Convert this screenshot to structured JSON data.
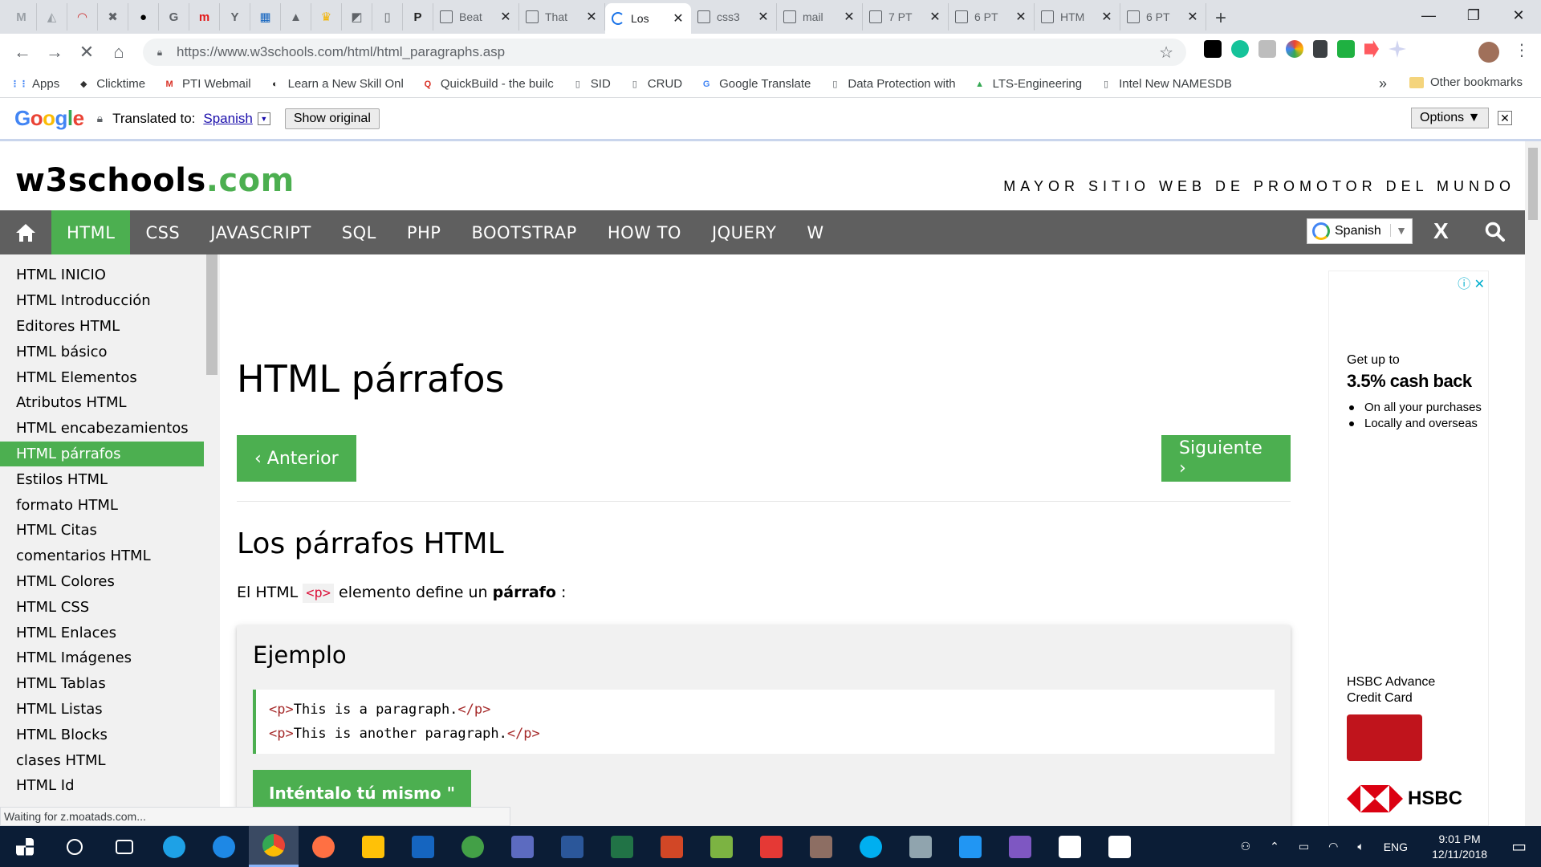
{
  "browser": {
    "pinned": [
      {
        "name": "gmail-icon",
        "color": "#9aa0a6",
        "glyph": "M"
      },
      {
        "name": "drive-icon",
        "color": "#9aa0a6",
        "glyph": "◭"
      },
      {
        "name": "app-icon",
        "color": "#cc3333",
        "glyph": "◠"
      },
      {
        "name": "app-icon",
        "color": "#5f6368",
        "glyph": "✖"
      },
      {
        "name": "github-icon",
        "color": "#000000",
        "glyph": "●"
      },
      {
        "name": "app-icon",
        "color": "#5f6368",
        "glyph": "G"
      },
      {
        "name": "app-icon",
        "color": "#e21b1b",
        "glyph": "m"
      },
      {
        "name": "y-icon",
        "color": "#5f6368",
        "glyph": "Y"
      },
      {
        "name": "app-icon",
        "color": "#1565c0",
        "glyph": "▦"
      },
      {
        "name": "app-icon",
        "color": "#5f6368",
        "glyph": "▲"
      },
      {
        "name": "crown-icon",
        "color": "#f4b400",
        "glyph": "♛"
      },
      {
        "name": "app-icon",
        "color": "#5f6368",
        "glyph": "◩"
      },
      {
        "name": "doc-icon",
        "color": "#5f6368",
        "glyph": "▯"
      },
      {
        "name": "phet-icon",
        "color": "#222222",
        "glyph": "P"
      }
    ],
    "tabs": [
      {
        "title": "Beat",
        "active": false
      },
      {
        "title": "That",
        "active": false
      },
      {
        "title": "Los",
        "active": true
      },
      {
        "title": "css3",
        "active": false
      },
      {
        "title": "mail",
        "active": false
      },
      {
        "title": "7 PT",
        "active": false
      },
      {
        "title": "6 PT",
        "active": false
      },
      {
        "title": "HTM",
        "active": false
      },
      {
        "title": "6 PT",
        "active": false
      }
    ],
    "tab_close": "✕",
    "new_tab": "+",
    "url": "https://www.w3schools.com/html/html_paragraphs.asp",
    "bookmarks": [
      {
        "label": "Apps",
        "color": "#4285f4",
        "glyph": "⋮⋮"
      },
      {
        "label": "Clicktime",
        "color": "#333333",
        "glyph": "◆"
      },
      {
        "label": "PTI Webmail",
        "color": "#d93025",
        "glyph": "M"
      },
      {
        "label": "Learn a New Skill Onl",
        "color": "#000000",
        "glyph": "◐"
      },
      {
        "label": "QuickBuild - the builc",
        "color": "#d93025",
        "glyph": "Q"
      },
      {
        "label": "SID",
        "color": "#5f6368",
        "glyph": "▯"
      },
      {
        "label": "CRUD",
        "color": "#5f6368",
        "glyph": "▯"
      },
      {
        "label": "Google Translate",
        "color": "#4285f4",
        "glyph": "G"
      },
      {
        "label": "Data Protection with",
        "color": "#5f6368",
        "glyph": "▯"
      },
      {
        "label": "LTS-Engineering",
        "color": "#34a853",
        "glyph": "▲"
      },
      {
        "label": "Intel New NAMESDB",
        "color": "#5f6368",
        "glyph": "▯"
      }
    ],
    "bookmarks_more": "»",
    "other_bookmarks": "Other bookmarks",
    "status": "Waiting for z.moatads.com..."
  },
  "translate": {
    "brand": [
      "G",
      "o",
      "o",
      "g",
      "l",
      "e"
    ],
    "label": "Translated to:",
    "language": "Spanish",
    "show_original": "Show original",
    "options": "Options ▼"
  },
  "site": {
    "logo_main": "w3schools",
    "logo_tld": ".com",
    "slogan": "MAYOR SITIO WEB DE PROMOTOR DEL MUNDO",
    "nav": [
      {
        "label": "HTML",
        "active": true
      },
      {
        "label": "CSS",
        "active": false
      },
      {
        "label": "JAVASCRIPT",
        "active": false
      },
      {
        "label": "SQL",
        "active": false
      },
      {
        "label": "PHP",
        "active": false
      },
      {
        "label": "BOOTSTRAP",
        "active": false
      },
      {
        "label": "HOW TO",
        "active": false
      },
      {
        "label": "JQUERY",
        "active": false
      },
      {
        "label": "W",
        "active": false
      }
    ],
    "translate_select": "Spanish",
    "nav_close": "X"
  },
  "sidebar": {
    "items": [
      {
        "label": "HTML INICIO",
        "active": false
      },
      {
        "label": "HTML Introducción",
        "active": false
      },
      {
        "label": "Editores HTML",
        "active": false
      },
      {
        "label": "HTML básico",
        "active": false
      },
      {
        "label": "HTML Elementos",
        "active": false
      },
      {
        "label": "Atributos HTML",
        "active": false
      },
      {
        "label": "HTML encabezamientos",
        "active": false
      },
      {
        "label": "HTML párrafos",
        "active": true
      },
      {
        "label": "Estilos HTML",
        "active": false
      },
      {
        "label": "formato HTML",
        "active": false
      },
      {
        "label": "HTML Citas",
        "active": false
      },
      {
        "label": "comentarios HTML",
        "active": false
      },
      {
        "label": "HTML Colores",
        "active": false
      },
      {
        "label": "HTML CSS",
        "active": false
      },
      {
        "label": "HTML Enlaces",
        "active": false
      },
      {
        "label": "HTML Imágenes",
        "active": false
      },
      {
        "label": "HTML Tablas",
        "active": false
      },
      {
        "label": "HTML Listas",
        "active": false
      },
      {
        "label": "HTML Blocks",
        "active": false
      },
      {
        "label": "clases HTML",
        "active": false
      },
      {
        "label": "HTML Id",
        "active": false
      }
    ]
  },
  "main": {
    "title": "HTML párrafos",
    "prev": "‹ Anterior",
    "next": "Siguiente ›",
    "section_title": "Los párrafos HTML",
    "para_before": "El HTML",
    "para_code": "<p>",
    "para_mid": "elemento define un",
    "para_bold": "párrafo",
    "para_end": ":",
    "example_title": "Ejemplo",
    "code_lines": [
      {
        "open": "<p>",
        "text": "This is a paragraph.",
        "close": "</p>"
      },
      {
        "open": "<p>",
        "text": "This is another paragraph.",
        "close": "</p>"
      }
    ],
    "tryit": "Inténtalo tú mismo \""
  },
  "ad": {
    "line1": "Get up to",
    "line2": "3.5% cash back",
    "bullets": [
      "On all your purchases",
      "Locally and overseas"
    ],
    "card_title": "HSBC Advance Credit Card",
    "brand": "HSBC",
    "close": "✕",
    "info": "ⓘ"
  },
  "taskbar": {
    "apps": [
      {
        "name": "start-icon",
        "color": "#ffffff"
      },
      {
        "name": "search-icon",
        "color": "#ffffff"
      },
      {
        "name": "task-view-icon",
        "color": "#ffffff"
      },
      {
        "name": "ie-icon",
        "color": "#1ea1e6"
      },
      {
        "name": "edge-icon",
        "color": "#1e88e5"
      },
      {
        "name": "chrome-icon",
        "color": "#e53935"
      },
      {
        "name": "firefox-icon",
        "color": "#ff7043"
      },
      {
        "name": "explorer-icon",
        "color": "#ffc107"
      },
      {
        "name": "outlook-icon",
        "color": "#1565c0"
      },
      {
        "name": "globe-icon",
        "color": "#43a047"
      },
      {
        "name": "app-icon",
        "color": "#5c6bc0"
      },
      {
        "name": "word-icon",
        "color": "#2b579a"
      },
      {
        "name": "excel-icon",
        "color": "#217346"
      },
      {
        "name": "powerpoint-icon",
        "color": "#d24726"
      },
      {
        "name": "app-icon",
        "color": "#7cb342"
      },
      {
        "name": "app-icon",
        "color": "#e53935"
      },
      {
        "name": "paint-icon",
        "color": "#8d6e63"
      },
      {
        "name": "skype-icon",
        "color": "#00aff0"
      },
      {
        "name": "app-icon",
        "color": "#90a4ae"
      },
      {
        "name": "vscode-icon",
        "color": "#2196f3"
      },
      {
        "name": "visual-studio-icon",
        "color": "#7e57c2"
      },
      {
        "name": "photos-icon",
        "color": "#ffffff"
      },
      {
        "name": "slack-icon",
        "color": "#ffffff"
      }
    ],
    "lang": "ENG",
    "time": "9:01 PM",
    "date": "12/11/2018"
  }
}
